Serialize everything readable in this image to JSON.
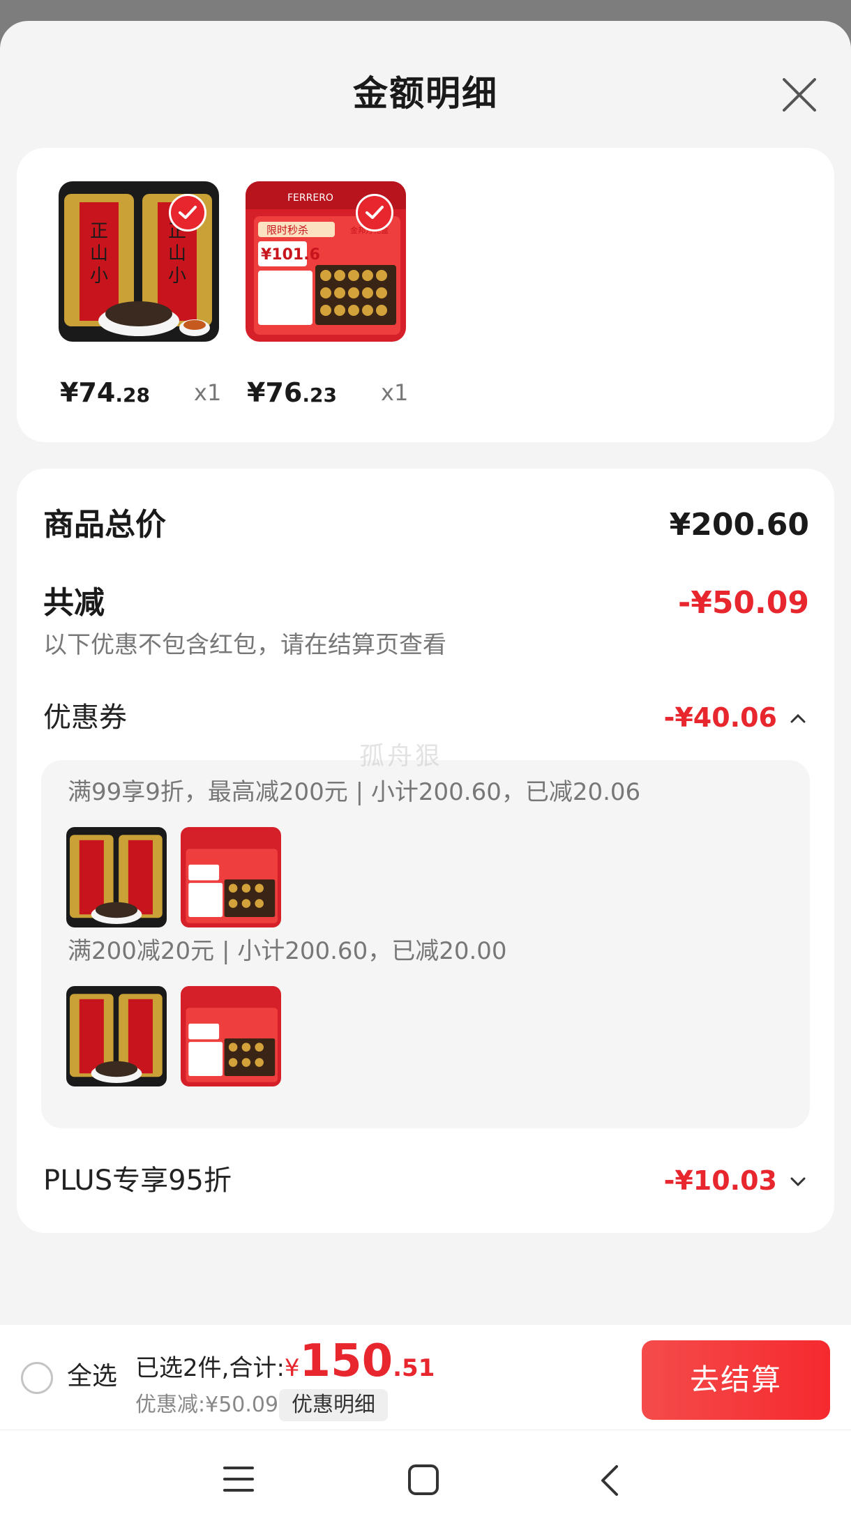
{
  "header": {
    "title": "金额明细",
    "close_icon": "close-icon"
  },
  "products": [
    {
      "price_int": "¥74",
      "price_dec": ".28",
      "qty": "x1",
      "image": "tea-cans-image",
      "selected": true
    },
    {
      "price_int": "¥76",
      "price_dec": ".23",
      "qty": "x1",
      "image": "ferrero-giftbox-image",
      "selected": true,
      "image_text": {
        "brand": "FERRERO",
        "tag": "限时秒杀",
        "price": "¥101.6",
        "badge": "金邦万礼盒"
      }
    }
  ],
  "summary": {
    "total_label": "商品总价",
    "total_value": "¥200.60",
    "discount_label": "共减",
    "discount_value": "-¥50.09",
    "note": "以下优惠不包含红包，请在结算页查看",
    "coupon_label": "优惠券",
    "coupon_value": "-¥40.06",
    "coupon_rules": [
      {
        "text": "满99享9折，最高减200元 | 小计200.60，已减20.06"
      },
      {
        "text": "满200减20元 | 小计200.60，已减20.00"
      }
    ],
    "plus_label": "PLUS专享95折",
    "plus_value": "-¥10.03"
  },
  "watermark": "孤舟狠",
  "bottom_bar": {
    "select_all": "全选",
    "selected_text": "已选2件,合计:",
    "currency": "¥",
    "total_int": "150",
    "total_dec": ".51",
    "saved_text": "优惠减:¥50.09",
    "detail_button": "优惠明细",
    "checkout_button": "去结算"
  },
  "nav": {
    "menu_icon": "menu-icon",
    "home_icon": "home-icon",
    "back_icon": "back-icon"
  },
  "colors": {
    "accent": "#e8262e",
    "background": "#f4f4f4"
  }
}
